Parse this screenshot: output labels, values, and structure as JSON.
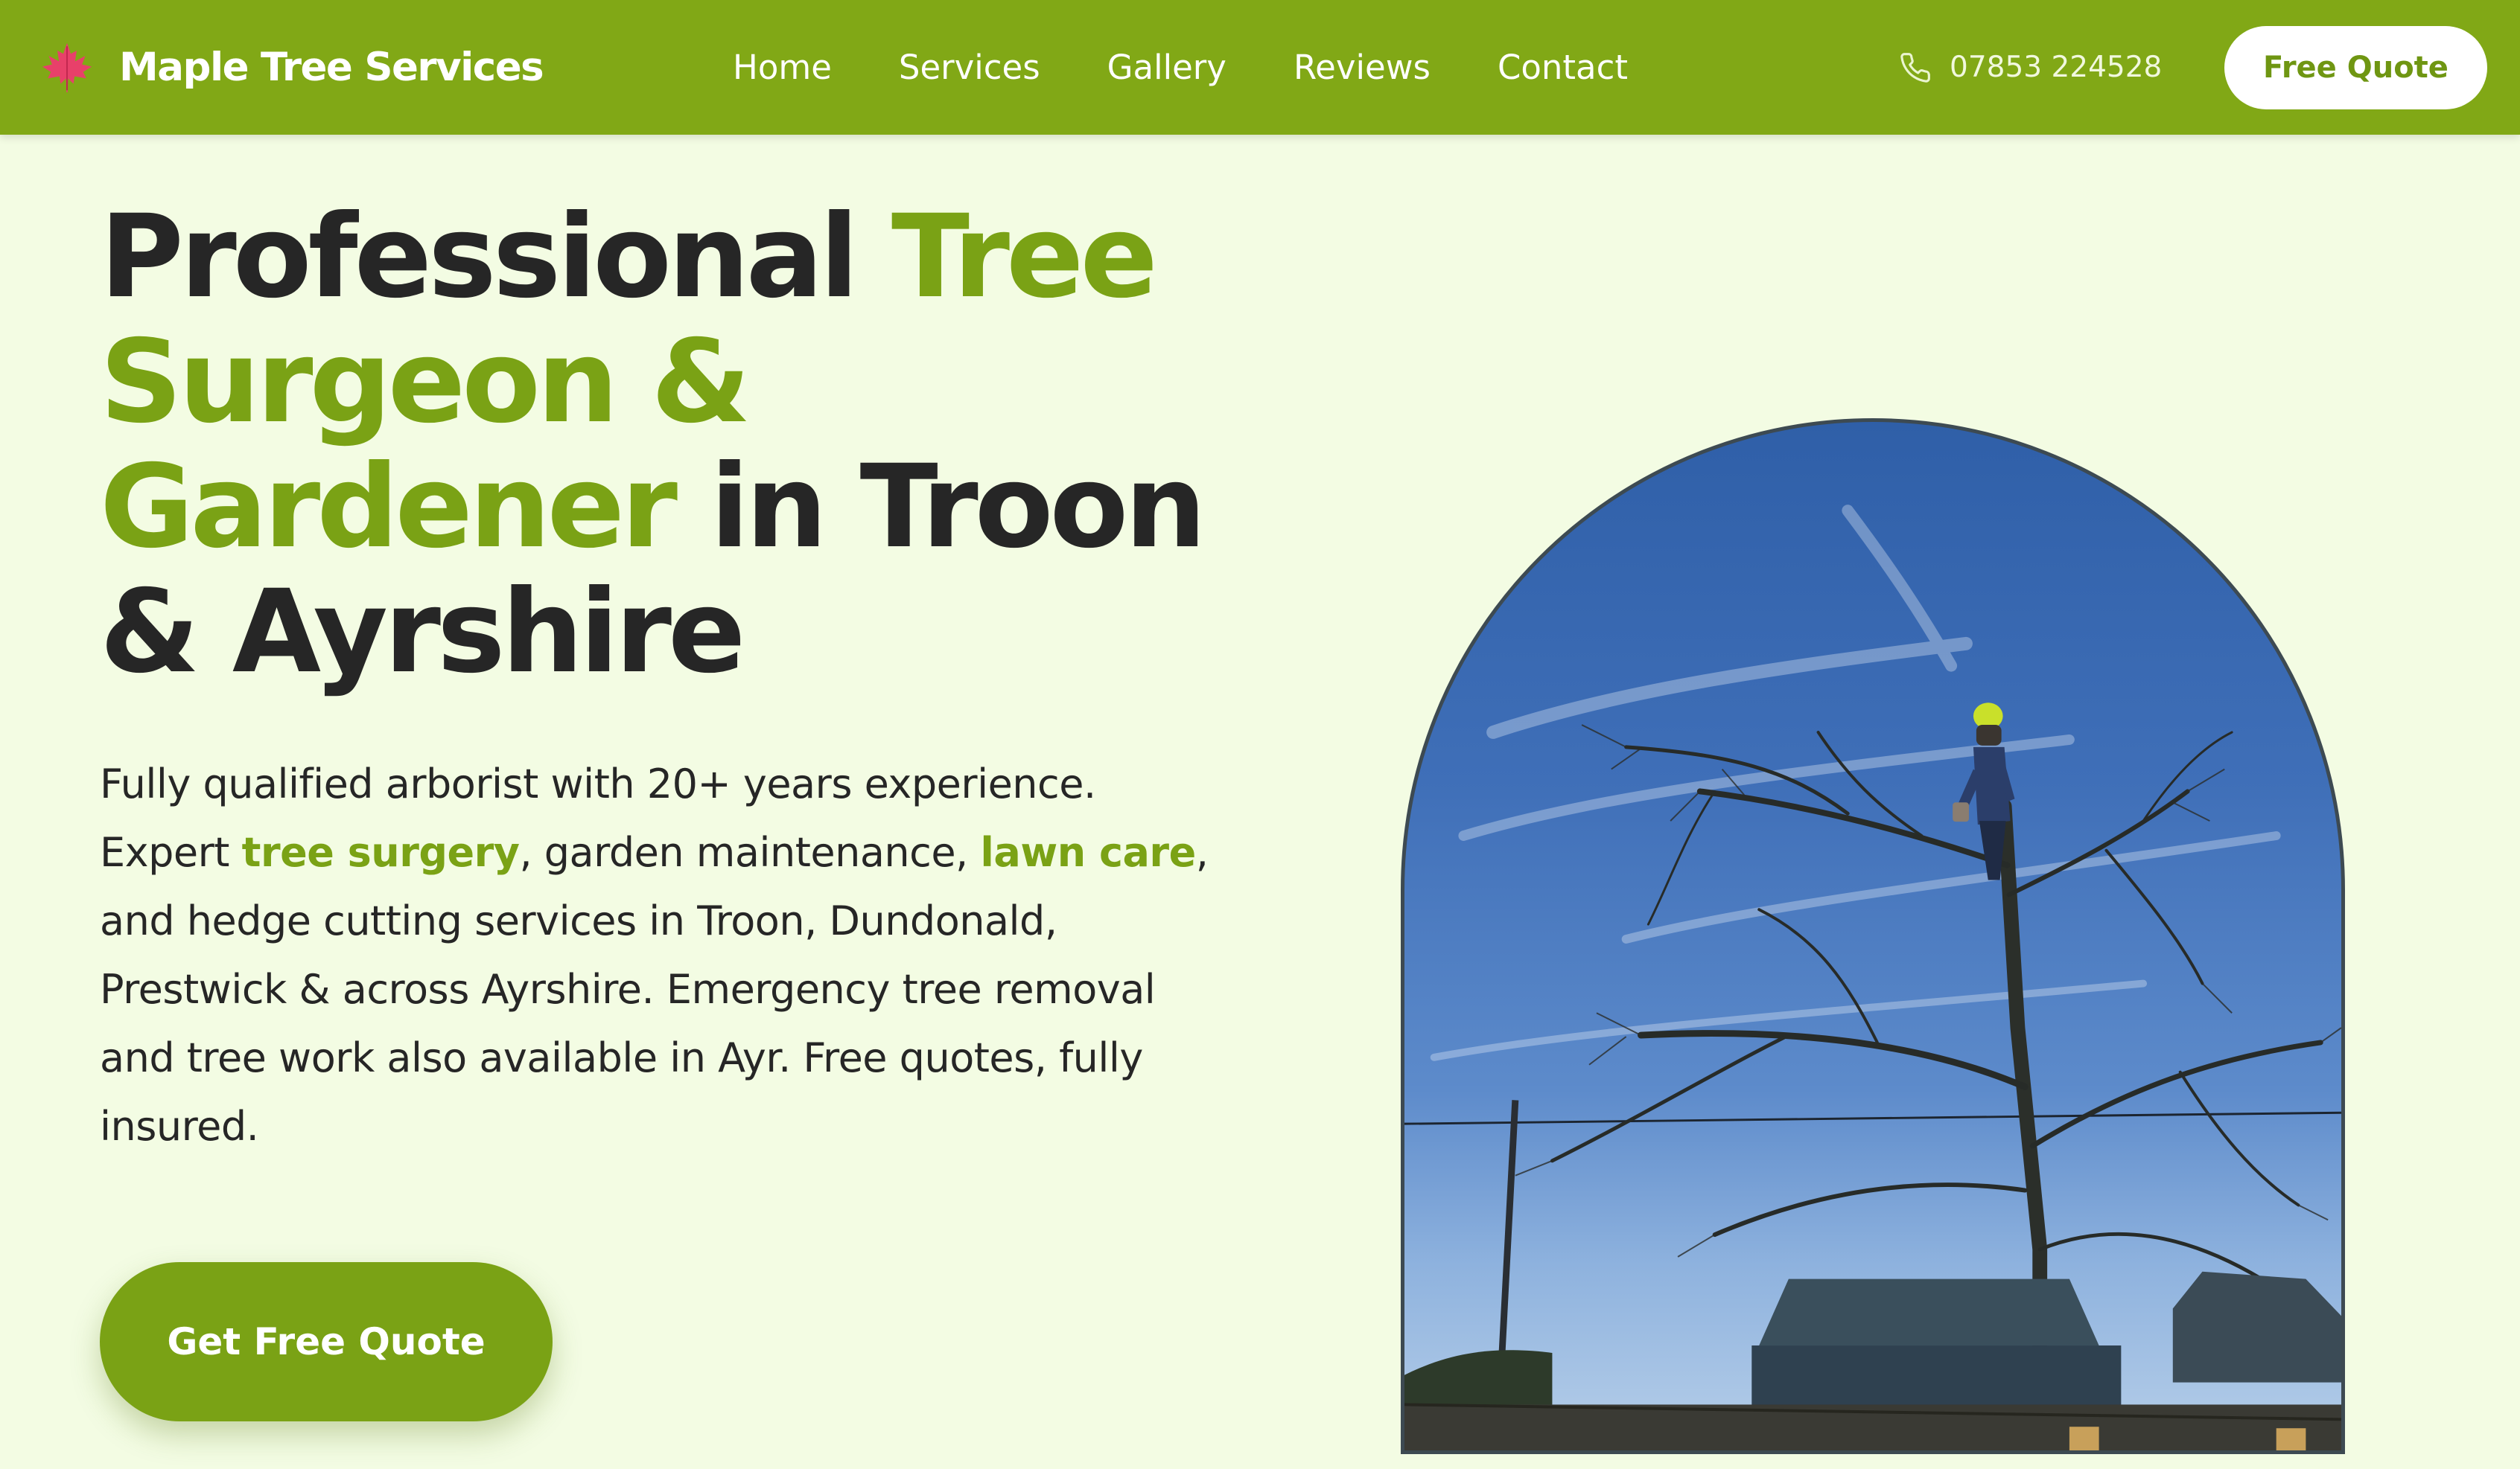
{
  "header": {
    "brand_name": "Maple Tree Services",
    "nav": [
      "Home",
      "Services",
      "Gallery",
      "Reviews",
      "Contact"
    ],
    "phone": "07853 224528",
    "quote_button": "Free Quote"
  },
  "hero": {
    "title": {
      "part1": "Professional ",
      "part2": "Tree Surgeon & Gardener",
      "part3": " in Troon & Ayrshire"
    },
    "description": {
      "part1": "Fully qualified arborist with 20+ years experience. Expert ",
      "link1": "tree surgery",
      "part2": ", garden maintenance, ",
      "link2": "lawn care",
      "part3": ", and hedge cutting services in Troon, Dundonald, Prestwick & across Ayrshire. Emergency tree removal and tree work also available in Ayr. Free quotes, fully insured."
    },
    "cta": "Get Free Quote"
  },
  "icons": {
    "logo": "maple-leaf-icon",
    "phone": "phone-icon"
  },
  "colors": {
    "brand_green": "#81a816",
    "accent_green": "#7aa215",
    "background": "#f3fce3",
    "text_dark": "#262626"
  }
}
